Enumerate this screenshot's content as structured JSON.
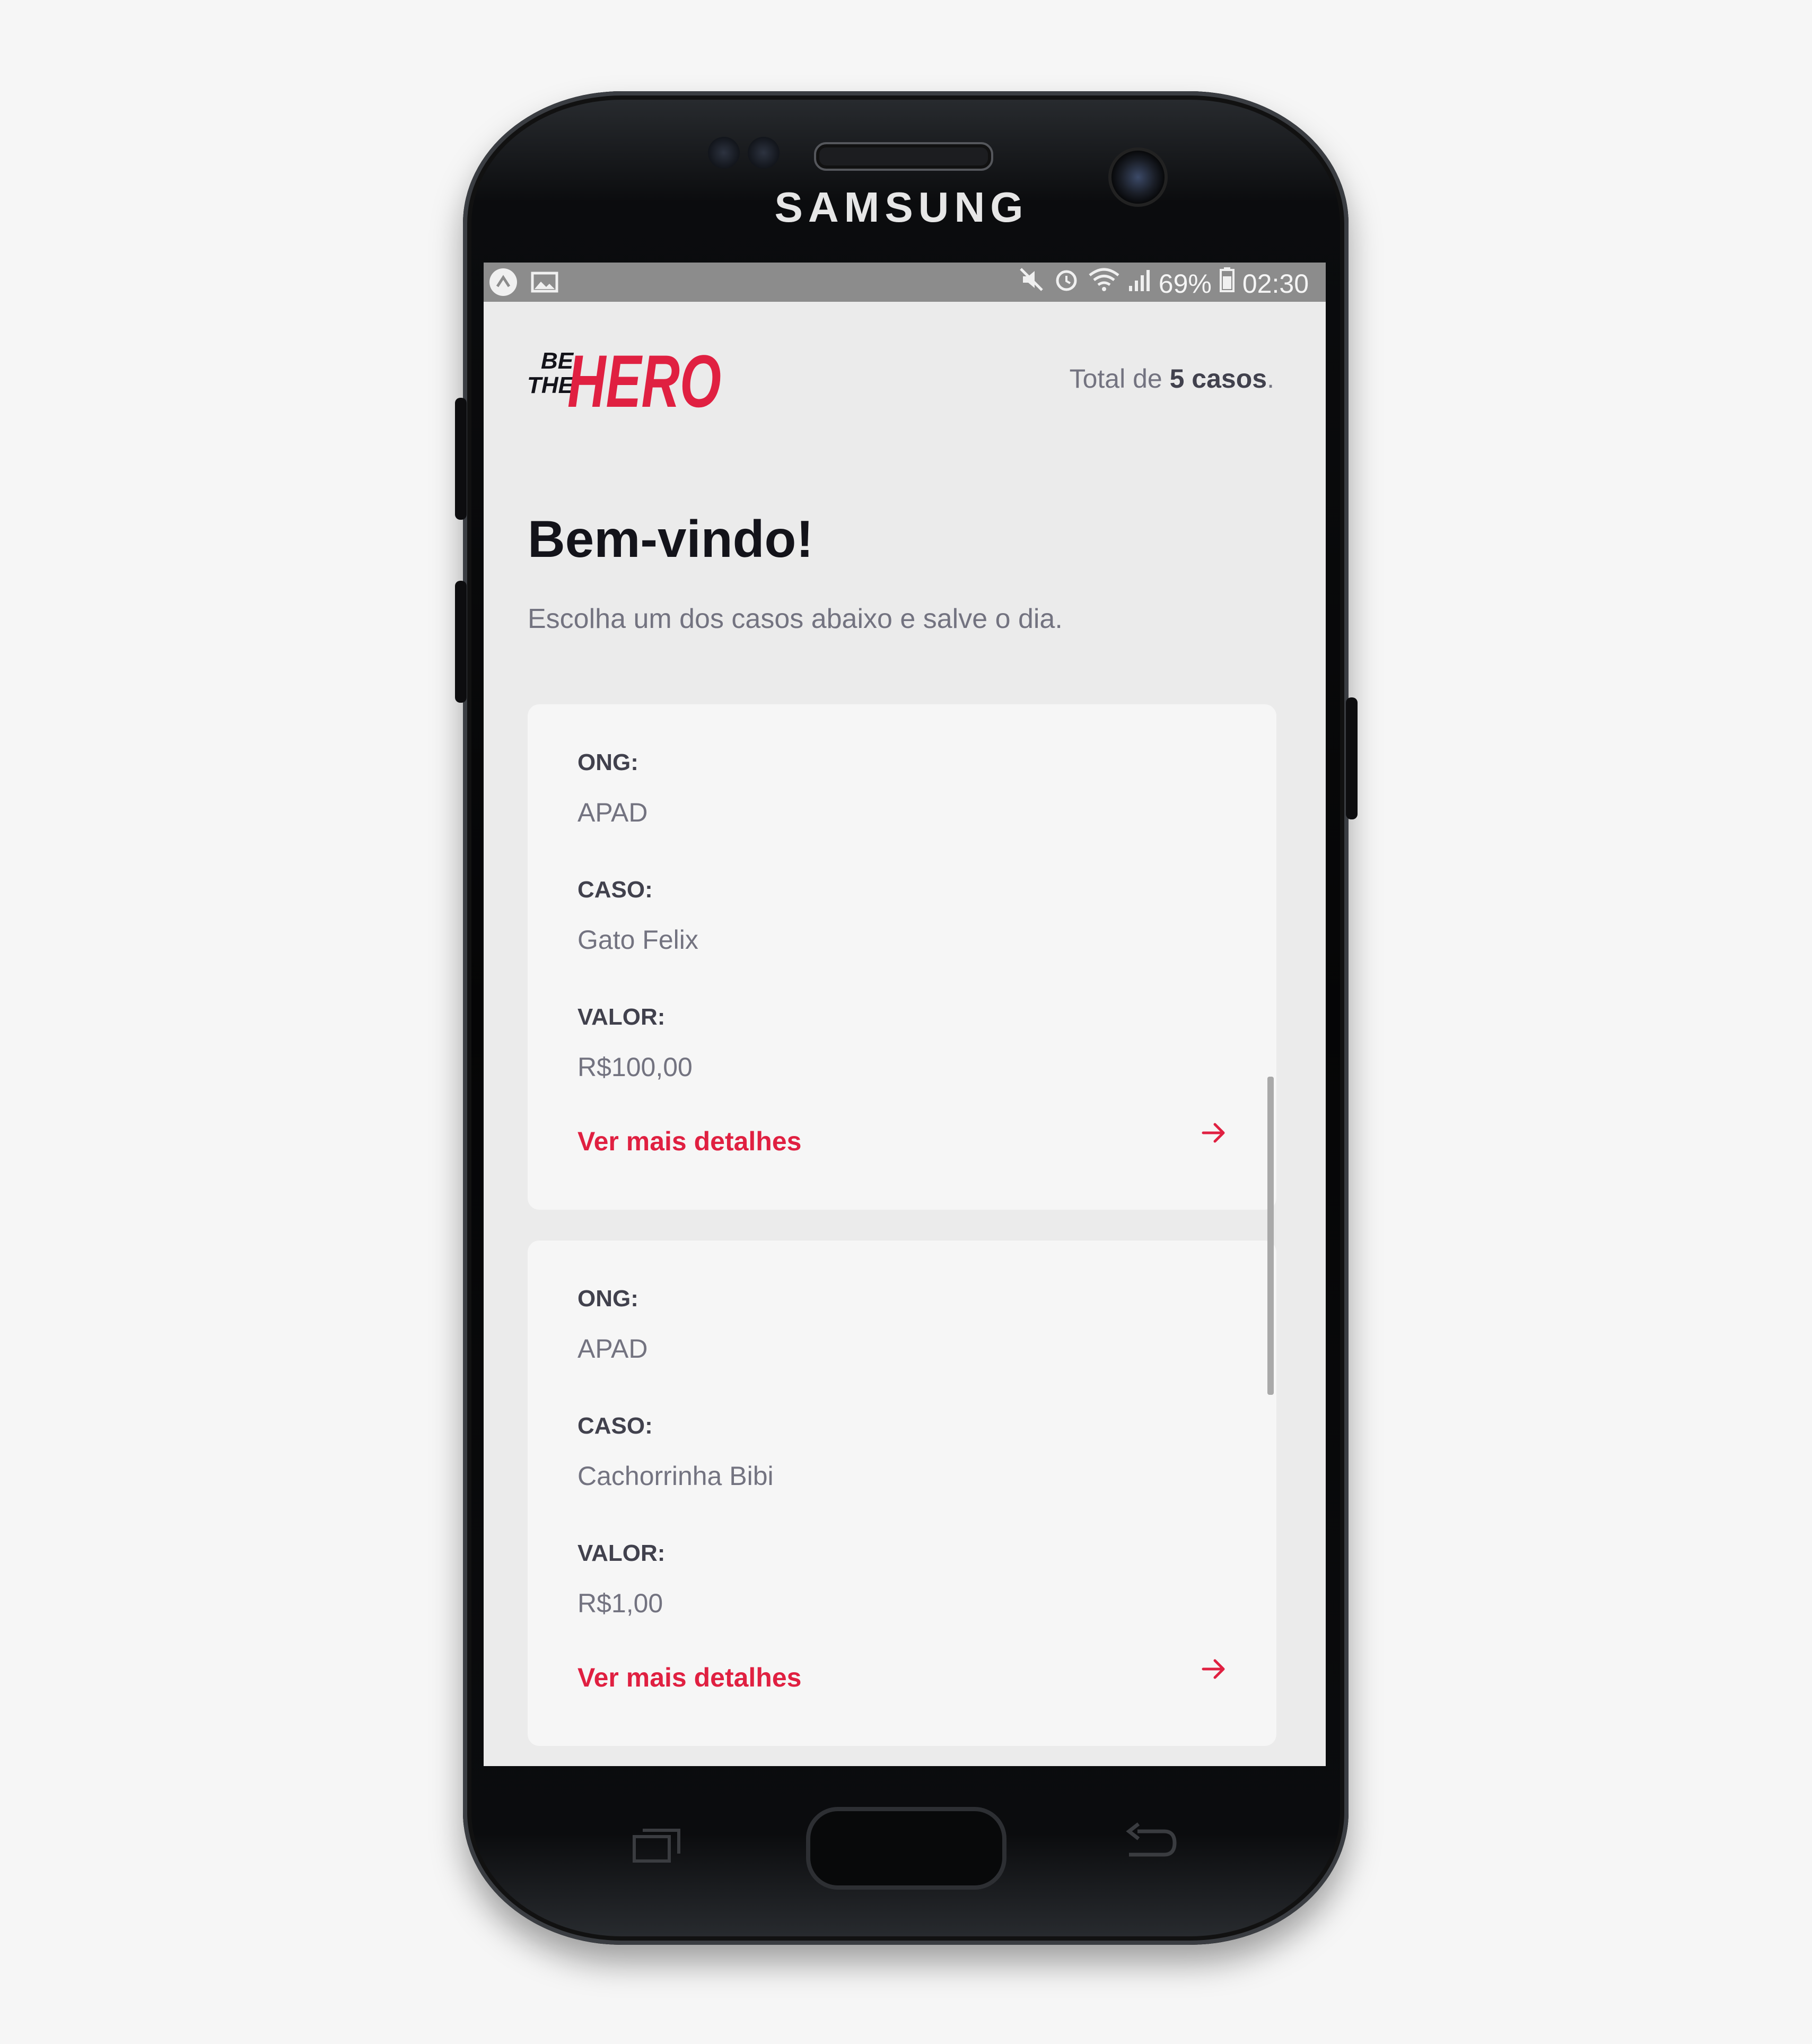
{
  "device": {
    "brand": "SAMSUNG"
  },
  "status_bar": {
    "battery": "69%",
    "time": "02:30"
  },
  "header": {
    "logo_text_be": "BE",
    "logo_text_the": "THE",
    "logo_text_hero": "HERO",
    "total_prefix": "Total de ",
    "total_bold": "5 casos",
    "total_suffix": "."
  },
  "page": {
    "title": "Bem-vindo!",
    "subtitle": "Escolha um dos casos abaixo e salve o dia."
  },
  "cases": [
    {
      "ong_label": "ONG:",
      "ong": "APAD",
      "caso_label": "CASO:",
      "caso": "Gato Felix",
      "valor_label": "VALOR:",
      "valor": "R$100,00",
      "details_label": "Ver mais detalhes"
    },
    {
      "ong_label": "ONG:",
      "ong": "APAD",
      "caso_label": "CASO:",
      "caso": "Cachorrinha Bibi",
      "valor_label": "VALOR:",
      "valor": "R$1,00",
      "details_label": "Ver mais detalhes"
    }
  ],
  "colors": {
    "accent": "#e02041",
    "background": "#ebebeb",
    "card": "#f6f6f6"
  }
}
